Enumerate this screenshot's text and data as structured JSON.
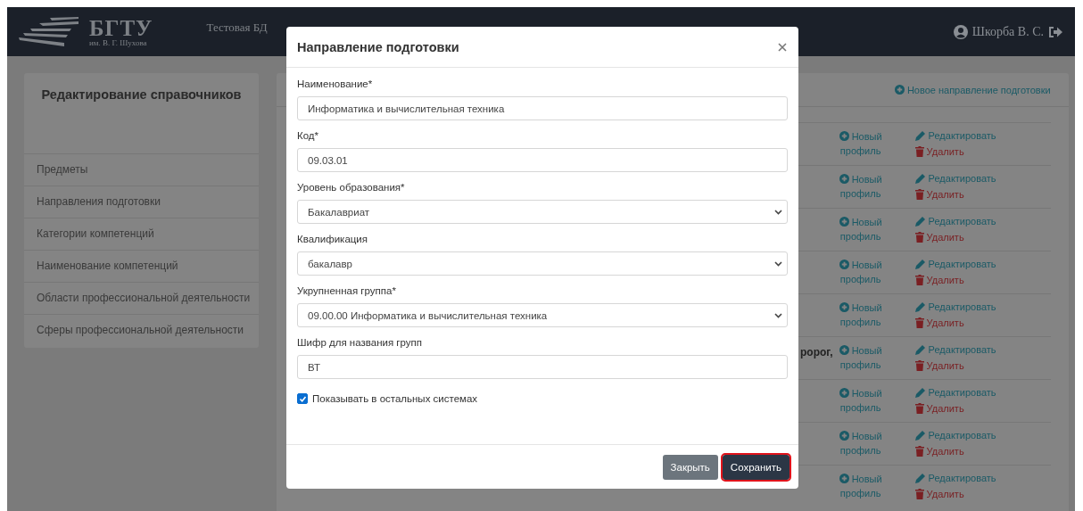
{
  "navbar": {
    "logo_title": "БГТУ",
    "logo_subtitle": "им. В. Г. Шухова",
    "database": "Тестовая БД",
    "user": "Шкорба В. С."
  },
  "sidebar": {
    "title": "Редактирование справочников",
    "items": [
      {
        "label": "Предметы"
      },
      {
        "label": "Направления подготовки"
      },
      {
        "label": "Категории компетенций"
      },
      {
        "label": "Наименование компетенций"
      },
      {
        "label": "Области профессиональной деятельности"
      },
      {
        "label": "Сферы профессиональной деятельности"
      }
    ]
  },
  "main": {
    "new_link": "Новое направление подготовки",
    "rows": [
      {
        "new_profile": "Новый профиль",
        "edit": "Редактировать",
        "delete": "Удалить"
      },
      {
        "new_profile": "Новый профиль",
        "edit": "Редактировать",
        "delete": "Удалить"
      },
      {
        "new_profile": "Новый профиль",
        "edit": "Редактировать",
        "delete": "Удалить"
      },
      {
        "new_profile": "Новый профиль",
        "edit": "Редактировать",
        "delete": "Удалить"
      },
      {
        "new_profile": "Новый профиль",
        "edit": "Редактировать",
        "delete": "Удалить"
      },
      {
        "name": "ророг,",
        "new_profile": "Новый профиль",
        "edit": "Редактировать",
        "delete": "Удалить"
      },
      {
        "new_profile": "Новый профиль",
        "edit": "Редактировать",
        "delete": "Удалить"
      },
      {
        "new_profile": "Новый профиль",
        "edit": "Редактировать",
        "delete": "Удалить"
      },
      {
        "new_profile": "Новый профиль",
        "edit": "Редактировать",
        "delete": "Удалить"
      }
    ]
  },
  "modal": {
    "title": "Направление подготовки",
    "fields": [
      {
        "kind": "text",
        "label": "Наименование*",
        "value": "Информатика и вычислительная техника"
      },
      {
        "kind": "text",
        "label": "Код*",
        "value": "09.03.01"
      },
      {
        "kind": "select",
        "label": "Уровень образования*",
        "value": "Бакалавриат"
      },
      {
        "kind": "select",
        "label": "Квалификация",
        "value": "бакалавр"
      },
      {
        "kind": "select",
        "label": "Укрупненная группа*",
        "value": "09.00.00 Информатика и вычислительная техника"
      },
      {
        "kind": "text",
        "label": "Шифр для названия групп",
        "value": "ВТ"
      }
    ],
    "checkbox": {
      "label": "Показывать в остальных системах",
      "checked": true
    },
    "buttons": [
      {
        "label": "Закрыть",
        "kind": "secondary",
        "focused": false
      },
      {
        "label": "Сохранить",
        "kind": "primary",
        "focused": true
      }
    ]
  }
}
